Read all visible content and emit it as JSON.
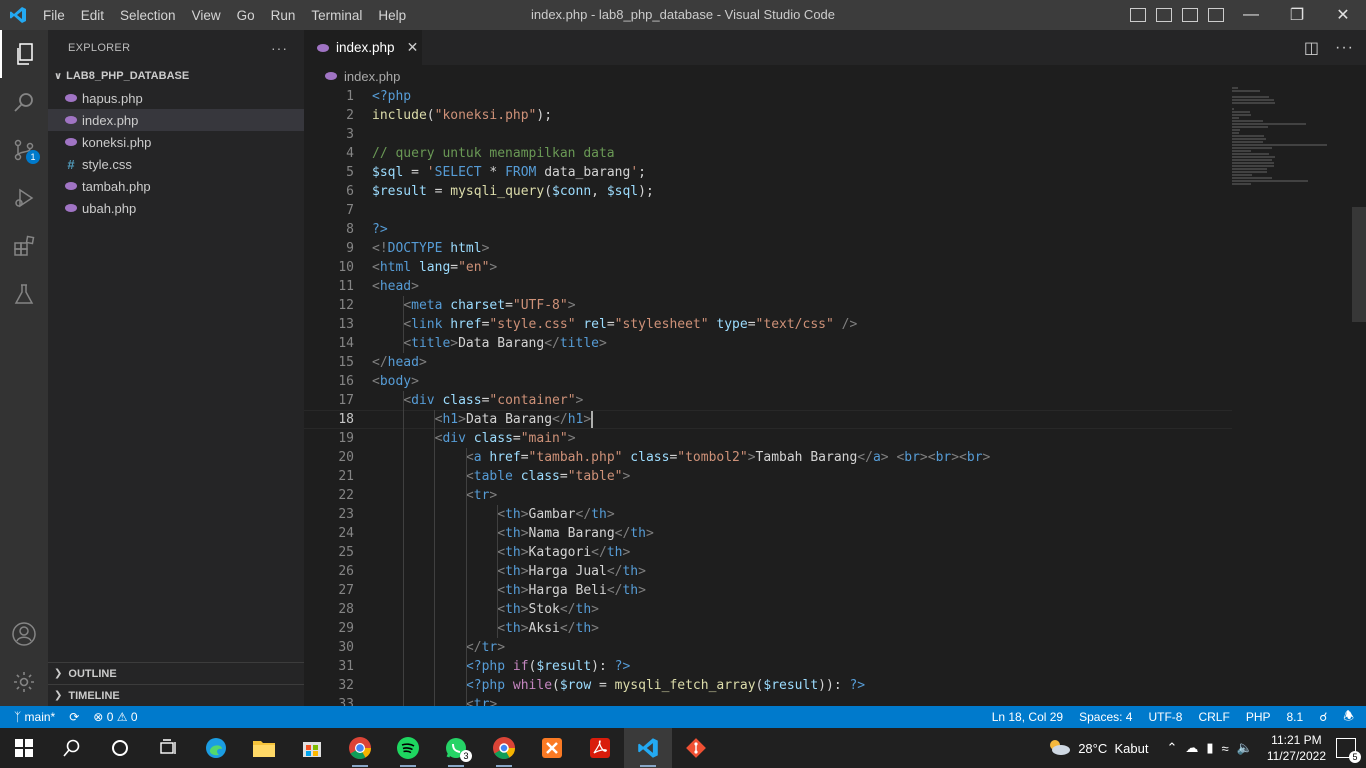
{
  "titlebar": {
    "menu": [
      "File",
      "Edit",
      "Selection",
      "View",
      "Go",
      "Run",
      "Terminal",
      "Help"
    ],
    "window_title": "index.php - lab8_php_database - Visual Studio Code"
  },
  "explorer": {
    "header": "EXPLORER",
    "folder": "LAB8_PHP_DATABASE",
    "files": [
      "hapus.php",
      "index.php",
      "koneksi.php",
      "style.css",
      "tambah.php",
      "ubah.php"
    ],
    "outline": "OUTLINE",
    "timeline": "TIMELINE"
  },
  "activity": {
    "scm_badge": "1"
  },
  "editor": {
    "tab": "index.php",
    "breadcrumb": "index.php",
    "line_numbers": [
      "1",
      "2",
      "3",
      "4",
      "5",
      "6",
      "7",
      "8",
      "9",
      "10",
      "11",
      "12",
      "13",
      "14",
      "15",
      "16",
      "17",
      "18",
      "19",
      "20",
      "21",
      "22",
      "23",
      "24",
      "25",
      "26",
      "27",
      "28",
      "29",
      "30",
      "31",
      "32",
      "33"
    ]
  },
  "code": [
    [
      {
        "t": "<?php",
        "c": "t-php"
      }
    ],
    [
      {
        "t": "include",
        "c": "t-fn"
      },
      {
        "t": "(",
        "c": "t-txt"
      },
      {
        "t": "\"koneksi.php\"",
        "c": "t-str"
      },
      {
        "t": ");",
        "c": "t-txt"
      }
    ],
    [],
    [
      {
        "t": "// query untuk menampilkan data",
        "c": "t-cm"
      }
    ],
    [
      {
        "t": "$sql",
        "c": "t-var"
      },
      {
        "t": " = ",
        "c": "t-txt"
      },
      {
        "t": "'",
        "c": "t-str"
      },
      {
        "t": "SELECT",
        "c": "t-php"
      },
      {
        "t": " * ",
        "c": "t-txt"
      },
      {
        "t": "FROM",
        "c": "t-php"
      },
      {
        "t": " data_barang",
        "c": "t-txt"
      },
      {
        "t": "'",
        "c": "t-str"
      },
      {
        "t": ";",
        "c": "t-txt"
      }
    ],
    [
      {
        "t": "$result",
        "c": "t-var"
      },
      {
        "t": " = ",
        "c": "t-txt"
      },
      {
        "t": "mysqli_query",
        "c": "t-fn"
      },
      {
        "t": "(",
        "c": "t-txt"
      },
      {
        "t": "$conn",
        "c": "t-var"
      },
      {
        "t": ", ",
        "c": "t-txt"
      },
      {
        "t": "$sql",
        "c": "t-var"
      },
      {
        "t": ");",
        "c": "t-txt"
      }
    ],
    [],
    [
      {
        "t": "?>",
        "c": "t-php"
      }
    ],
    [
      {
        "t": "<!",
        "c": "t-br"
      },
      {
        "t": "DOCTYPE",
        "c": "t-tag"
      },
      {
        "t": " html",
        "c": "t-attr"
      },
      {
        "t": ">",
        "c": "t-br"
      }
    ],
    [
      {
        "t": "<",
        "c": "t-br"
      },
      {
        "t": "html",
        "c": "t-tag"
      },
      {
        "t": " lang",
        "c": "t-attr"
      },
      {
        "t": "=",
        "c": "t-txt"
      },
      {
        "t": "\"en\"",
        "c": "t-str"
      },
      {
        "t": ">",
        "c": "t-br"
      }
    ],
    [
      {
        "t": "<",
        "c": "t-br"
      },
      {
        "t": "head",
        "c": "t-tag"
      },
      {
        "t": ">",
        "c": "t-br"
      }
    ],
    [
      {
        "t": "    ",
        "c": "t-txt"
      },
      {
        "t": "<",
        "c": "t-br"
      },
      {
        "t": "meta",
        "c": "t-tag"
      },
      {
        "t": " charset",
        "c": "t-attr"
      },
      {
        "t": "=",
        "c": "t-txt"
      },
      {
        "t": "\"UTF-8\"",
        "c": "t-str"
      },
      {
        "t": ">",
        "c": "t-br"
      }
    ],
    [
      {
        "t": "    ",
        "c": "t-txt"
      },
      {
        "t": "<",
        "c": "t-br"
      },
      {
        "t": "link",
        "c": "t-tag"
      },
      {
        "t": " href",
        "c": "t-attr"
      },
      {
        "t": "=",
        "c": "t-txt"
      },
      {
        "t": "\"style.css\"",
        "c": "t-str"
      },
      {
        "t": " rel",
        "c": "t-attr"
      },
      {
        "t": "=",
        "c": "t-txt"
      },
      {
        "t": "\"stylesheet\"",
        "c": "t-str"
      },
      {
        "t": " type",
        "c": "t-attr"
      },
      {
        "t": "=",
        "c": "t-txt"
      },
      {
        "t": "\"text/css\"",
        "c": "t-str"
      },
      {
        "t": " />",
        "c": "t-br"
      }
    ],
    [
      {
        "t": "    ",
        "c": "t-txt"
      },
      {
        "t": "<",
        "c": "t-br"
      },
      {
        "t": "title",
        "c": "t-tag"
      },
      {
        "t": ">",
        "c": "t-br"
      },
      {
        "t": "Data Barang",
        "c": "t-txt"
      },
      {
        "t": "</",
        "c": "t-br"
      },
      {
        "t": "title",
        "c": "t-tag"
      },
      {
        "t": ">",
        "c": "t-br"
      }
    ],
    [
      {
        "t": "</",
        "c": "t-br"
      },
      {
        "t": "head",
        "c": "t-tag"
      },
      {
        "t": ">",
        "c": "t-br"
      }
    ],
    [
      {
        "t": "<",
        "c": "t-br"
      },
      {
        "t": "body",
        "c": "t-tag"
      },
      {
        "t": ">",
        "c": "t-br"
      }
    ],
    [
      {
        "t": "    ",
        "c": "t-txt"
      },
      {
        "t": "<",
        "c": "t-br"
      },
      {
        "t": "div",
        "c": "t-tag"
      },
      {
        "t": " class",
        "c": "t-attr"
      },
      {
        "t": "=",
        "c": "t-txt"
      },
      {
        "t": "\"container\"",
        "c": "t-str"
      },
      {
        "t": ">",
        "c": "t-br"
      }
    ],
    [
      {
        "t": "        ",
        "c": "t-txt"
      },
      {
        "t": "<",
        "c": "t-br"
      },
      {
        "t": "h1",
        "c": "t-tag"
      },
      {
        "t": ">",
        "c": "t-br"
      },
      {
        "t": "Data Barang",
        "c": "t-txt"
      },
      {
        "t": "</",
        "c": "t-br"
      },
      {
        "t": "h1",
        "c": "t-tag"
      },
      {
        "t": ">",
        "c": "t-br"
      }
    ],
    [
      {
        "t": "        ",
        "c": "t-txt"
      },
      {
        "t": "<",
        "c": "t-br"
      },
      {
        "t": "div",
        "c": "t-tag"
      },
      {
        "t": " class",
        "c": "t-attr"
      },
      {
        "t": "=",
        "c": "t-txt"
      },
      {
        "t": "\"main\"",
        "c": "t-str"
      },
      {
        "t": ">",
        "c": "t-br"
      }
    ],
    [
      {
        "t": "            ",
        "c": "t-txt"
      },
      {
        "t": "<",
        "c": "t-br"
      },
      {
        "t": "a",
        "c": "t-tag"
      },
      {
        "t": " href",
        "c": "t-attr"
      },
      {
        "t": "=",
        "c": "t-txt"
      },
      {
        "t": "\"tambah.php\"",
        "c": "t-str"
      },
      {
        "t": " class",
        "c": "t-attr"
      },
      {
        "t": "=",
        "c": "t-txt"
      },
      {
        "t": "\"tombol2\"",
        "c": "t-str"
      },
      {
        "t": ">",
        "c": "t-br"
      },
      {
        "t": "Tambah Barang",
        "c": "t-txt"
      },
      {
        "t": "</",
        "c": "t-br"
      },
      {
        "t": "a",
        "c": "t-tag"
      },
      {
        "t": ">",
        "c": "t-br"
      },
      {
        "t": " ",
        "c": "t-txt"
      },
      {
        "t": "<",
        "c": "t-br"
      },
      {
        "t": "br",
        "c": "t-tag"
      },
      {
        "t": "><",
        "c": "t-br"
      },
      {
        "t": "br",
        "c": "t-tag"
      },
      {
        "t": "><",
        "c": "t-br"
      },
      {
        "t": "br",
        "c": "t-tag"
      },
      {
        "t": ">",
        "c": "t-br"
      }
    ],
    [
      {
        "t": "            ",
        "c": "t-txt"
      },
      {
        "t": "<",
        "c": "t-br"
      },
      {
        "t": "table",
        "c": "t-tag"
      },
      {
        "t": " class",
        "c": "t-attr"
      },
      {
        "t": "=",
        "c": "t-txt"
      },
      {
        "t": "\"table\"",
        "c": "t-str"
      },
      {
        "t": ">",
        "c": "t-br"
      }
    ],
    [
      {
        "t": "            ",
        "c": "t-txt"
      },
      {
        "t": "<",
        "c": "t-br"
      },
      {
        "t": "tr",
        "c": "t-tag"
      },
      {
        "t": ">",
        "c": "t-br"
      }
    ],
    [
      {
        "t": "                ",
        "c": "t-txt"
      },
      {
        "t": "<",
        "c": "t-br"
      },
      {
        "t": "th",
        "c": "t-tag"
      },
      {
        "t": ">",
        "c": "t-br"
      },
      {
        "t": "Gambar",
        "c": "t-txt"
      },
      {
        "t": "</",
        "c": "t-br"
      },
      {
        "t": "th",
        "c": "t-tag"
      },
      {
        "t": ">",
        "c": "t-br"
      }
    ],
    [
      {
        "t": "                ",
        "c": "t-txt"
      },
      {
        "t": "<",
        "c": "t-br"
      },
      {
        "t": "th",
        "c": "t-tag"
      },
      {
        "t": ">",
        "c": "t-br"
      },
      {
        "t": "Nama Barang",
        "c": "t-txt"
      },
      {
        "t": "</",
        "c": "t-br"
      },
      {
        "t": "th",
        "c": "t-tag"
      },
      {
        "t": ">",
        "c": "t-br"
      }
    ],
    [
      {
        "t": "                ",
        "c": "t-txt"
      },
      {
        "t": "<",
        "c": "t-br"
      },
      {
        "t": "th",
        "c": "t-tag"
      },
      {
        "t": ">",
        "c": "t-br"
      },
      {
        "t": "Katagori",
        "c": "t-txt"
      },
      {
        "t": "</",
        "c": "t-br"
      },
      {
        "t": "th",
        "c": "t-tag"
      },
      {
        "t": ">",
        "c": "t-br"
      }
    ],
    [
      {
        "t": "                ",
        "c": "t-txt"
      },
      {
        "t": "<",
        "c": "t-br"
      },
      {
        "t": "th",
        "c": "t-tag"
      },
      {
        "t": ">",
        "c": "t-br"
      },
      {
        "t": "Harga Jual",
        "c": "t-txt"
      },
      {
        "t": "</",
        "c": "t-br"
      },
      {
        "t": "th",
        "c": "t-tag"
      },
      {
        "t": ">",
        "c": "t-br"
      }
    ],
    [
      {
        "t": "                ",
        "c": "t-txt"
      },
      {
        "t": "<",
        "c": "t-br"
      },
      {
        "t": "th",
        "c": "t-tag"
      },
      {
        "t": ">",
        "c": "t-br"
      },
      {
        "t": "Harga Beli",
        "c": "t-txt"
      },
      {
        "t": "</",
        "c": "t-br"
      },
      {
        "t": "th",
        "c": "t-tag"
      },
      {
        "t": ">",
        "c": "t-br"
      }
    ],
    [
      {
        "t": "                ",
        "c": "t-txt"
      },
      {
        "t": "<",
        "c": "t-br"
      },
      {
        "t": "th",
        "c": "t-tag"
      },
      {
        "t": ">",
        "c": "t-br"
      },
      {
        "t": "Stok",
        "c": "t-txt"
      },
      {
        "t": "</",
        "c": "t-br"
      },
      {
        "t": "th",
        "c": "t-tag"
      },
      {
        "t": ">",
        "c": "t-br"
      }
    ],
    [
      {
        "t": "                ",
        "c": "t-txt"
      },
      {
        "t": "<",
        "c": "t-br"
      },
      {
        "t": "th",
        "c": "t-tag"
      },
      {
        "t": ">",
        "c": "t-br"
      },
      {
        "t": "Aksi",
        "c": "t-txt"
      },
      {
        "t": "</",
        "c": "t-br"
      },
      {
        "t": "th",
        "c": "t-tag"
      },
      {
        "t": ">",
        "c": "t-br"
      }
    ],
    [
      {
        "t": "            ",
        "c": "t-txt"
      },
      {
        "t": "</",
        "c": "t-br"
      },
      {
        "t": "tr",
        "c": "t-tag"
      },
      {
        "t": ">",
        "c": "t-br"
      }
    ],
    [
      {
        "t": "            ",
        "c": "t-txt"
      },
      {
        "t": "<?php",
        "c": "t-php"
      },
      {
        "t": " ",
        "c": "t-txt"
      },
      {
        "t": "if",
        "c": "t-kw"
      },
      {
        "t": "(",
        "c": "t-txt"
      },
      {
        "t": "$result",
        "c": "t-var"
      },
      {
        "t": "): ",
        "c": "t-txt"
      },
      {
        "t": "?>",
        "c": "t-php"
      }
    ],
    [
      {
        "t": "            ",
        "c": "t-txt"
      },
      {
        "t": "<?php",
        "c": "t-php"
      },
      {
        "t": " ",
        "c": "t-txt"
      },
      {
        "t": "while",
        "c": "t-kw"
      },
      {
        "t": "(",
        "c": "t-txt"
      },
      {
        "t": "$row",
        "c": "t-var"
      },
      {
        "t": " = ",
        "c": "t-txt"
      },
      {
        "t": "mysqli_fetch_array",
        "c": "t-fn"
      },
      {
        "t": "(",
        "c": "t-txt"
      },
      {
        "t": "$result",
        "c": "t-var"
      },
      {
        "t": ")): ",
        "c": "t-txt"
      },
      {
        "t": "?>",
        "c": "t-php"
      }
    ],
    [
      {
        "t": "            ",
        "c": "t-txt"
      },
      {
        "t": "<",
        "c": "t-br"
      },
      {
        "t": "tr",
        "c": "t-tag"
      },
      {
        "t": ">",
        "c": "t-br"
      }
    ]
  ],
  "statusbar": {
    "branch": "main*",
    "problems": "0",
    "warnings": "0",
    "position": "Ln 18, Col 29",
    "spaces": "Spaces: 4",
    "encoding": "UTF-8",
    "eol": "CRLF",
    "language": "PHP",
    "version": "8.1"
  },
  "taskbar": {
    "weather": "28°C  Kabut",
    "time": "11:21 PM",
    "date": "11/27/2022",
    "notifications": "5",
    "whatsapp_badge": "3"
  },
  "colors": {
    "accent": "#007acc",
    "php_icon": "#a074c4"
  }
}
